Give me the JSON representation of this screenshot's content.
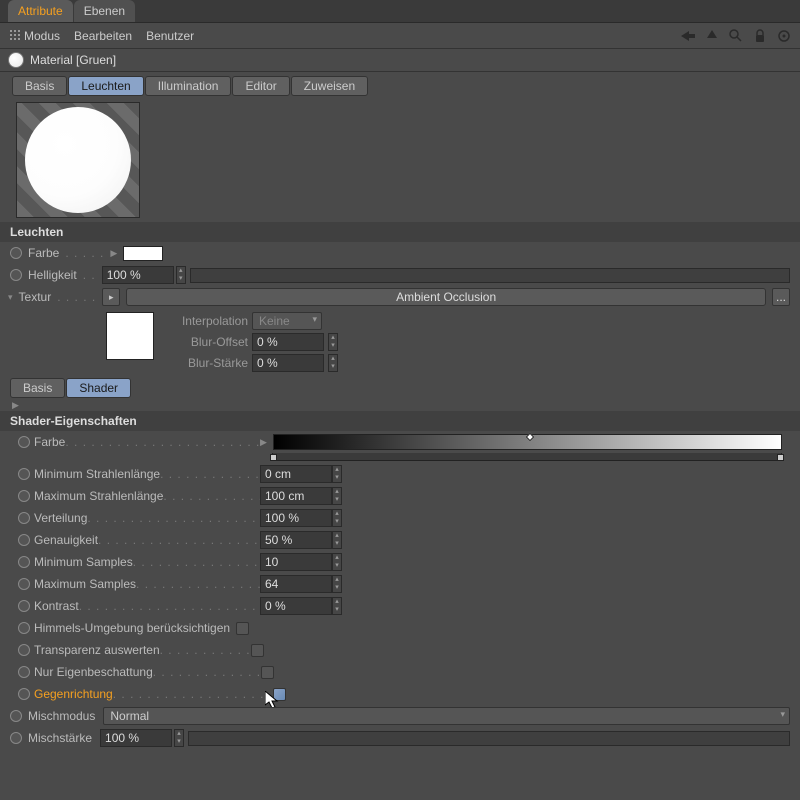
{
  "top_tabs": {
    "attribute": "Attribute",
    "ebenen": "Ebenen"
  },
  "menubar": {
    "modus": "Modus",
    "bearbeiten": "Bearbeiten",
    "benutzer": "Benutzer"
  },
  "material": {
    "title": "Material [Gruen]"
  },
  "sub_tabs": {
    "basis": "Basis",
    "leuchten": "Leuchten",
    "illumination": "Illumination",
    "editor": "Editor",
    "zuweisen": "Zuweisen"
  },
  "section": {
    "leuchten": "Leuchten",
    "shader_props": "Shader-Eigenschaften"
  },
  "channel": {
    "farbe": "Farbe",
    "helligkeit": "Helligkeit",
    "helligkeit_val": "100 %",
    "textur": "Textur",
    "textur_name": "Ambient Occlusion"
  },
  "tex": {
    "interpolation": "Interpolation",
    "interpolation_val": "Keine",
    "blur_offset": "Blur-Offset",
    "blur_offset_val": "0 %",
    "blur_staerke": "Blur-Stärke",
    "blur_staerke_val": "0 %"
  },
  "shader_tabs": {
    "basis": "Basis",
    "shader": "Shader"
  },
  "shader": {
    "farbe": "Farbe",
    "min_strahl": "Minimum Strahlenlänge",
    "min_strahl_val": "0 cm",
    "max_strahl": "Maximum Strahlenlänge",
    "max_strahl_val": "100 cm",
    "verteilung": "Verteilung",
    "verteilung_val": "100 %",
    "genauigkeit": "Genauigkeit",
    "genauigkeit_val": "50 %",
    "min_samples": "Minimum Samples",
    "min_samples_val": "10",
    "max_samples": "Maximum Samples",
    "max_samples_val": "64",
    "kontrast": "Kontrast",
    "kontrast_val": "0 %",
    "himmel": "Himmels-Umgebung berücksichtigen",
    "transparenz": "Transparenz auswerten",
    "eigenbeschattung": "Nur Eigenbeschattung",
    "gegenrichtung": "Gegenrichtung"
  },
  "mix": {
    "modus": "Mischmodus",
    "modus_val": "Normal",
    "staerke": "Mischstärke",
    "staerke_val": "100 %"
  },
  "misc": {
    "dots_btn": "..."
  }
}
